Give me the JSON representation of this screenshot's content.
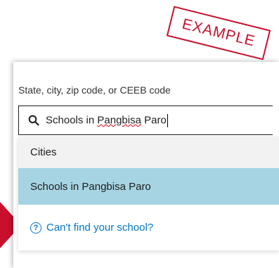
{
  "stamp": {
    "label": "EXAMPLE"
  },
  "search": {
    "label": "State, city, zip code, or CEEB code",
    "value_prefix": "Schools in ",
    "value_misspelled": "Pangbisa",
    "value_suffix": " Paro",
    "icon": "search-icon"
  },
  "dropdown": {
    "cities_label": "Cities",
    "school_option": "Schools in Pangbisa Paro",
    "help_link": "Can't find your school?",
    "help_icon": "question-circle-icon"
  },
  "colors": {
    "accent_red": "#c8102e",
    "selected_bg": "#a6d4e2",
    "link_blue": "#0077c8"
  }
}
